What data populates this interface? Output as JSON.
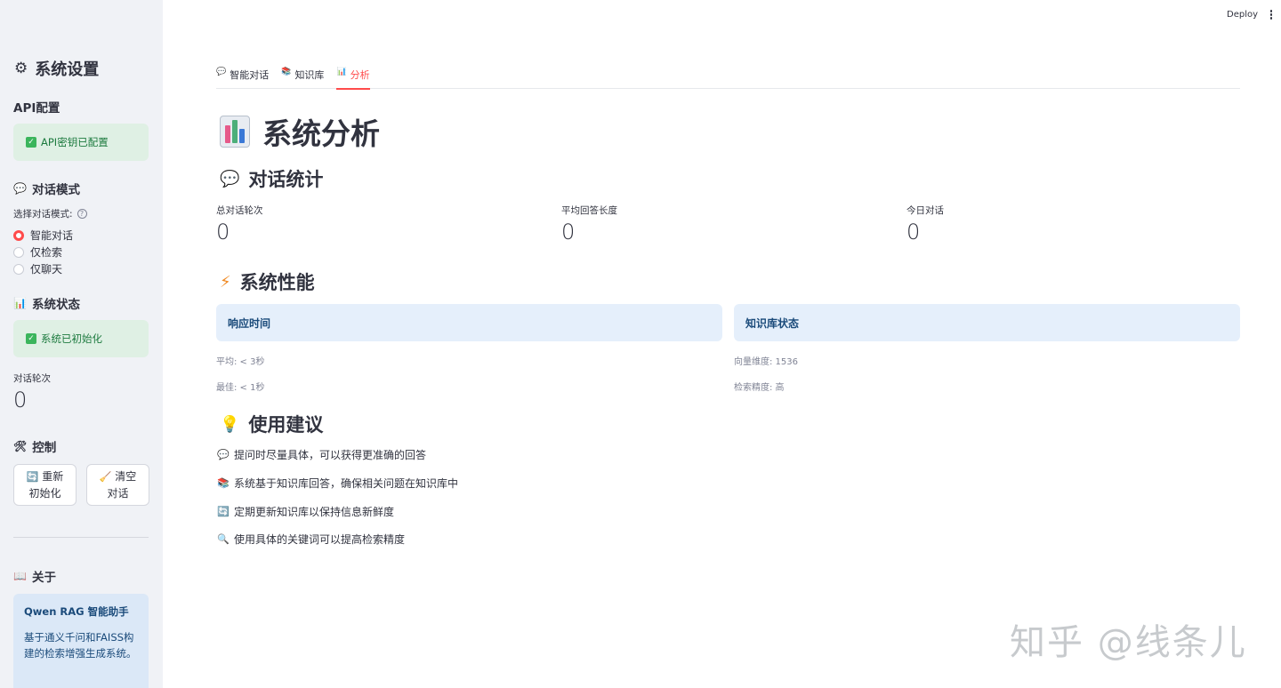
{
  "sidebar": {
    "title": "系统设置",
    "title_icon": "gear-icon",
    "api_header": "API配置",
    "api_status": "API密钥已配置",
    "mode_header": "对话模式",
    "mode_icon": "speech-bubble-icon",
    "radio_label": "选择对话模式:",
    "modes": [
      {
        "label": "智能对话",
        "selected": true
      },
      {
        "label": "仅检索",
        "selected": false
      },
      {
        "label": "仅聊天",
        "selected": false
      }
    ],
    "status_header": "系统状态",
    "status_icon": "bar-chart-icon",
    "status_text": "系统已初始化",
    "rounds_label": "对话轮次",
    "rounds_value": "0",
    "control_header": "控制",
    "control_icon": "tools-icon",
    "reinit_line1": "重新",
    "reinit_line2": "初始化",
    "clear_line1": "清空",
    "clear_line2": "对话",
    "about_header": "关于",
    "about_icon": "book-icon",
    "about_title": "Qwen RAG 智能助手",
    "about_desc": "基于通义千问和FAISS构建的检索增强生成系统。"
  },
  "topbar": {
    "deploy": "Deploy"
  },
  "tabs": [
    {
      "label": "智能对话",
      "icon": "speech-bubble-icon",
      "active": false
    },
    {
      "label": "知识库",
      "icon": "books-icon",
      "active": false
    },
    {
      "label": "分析",
      "icon": "bar-chart-icon",
      "active": true
    }
  ],
  "main": {
    "title": "系统分析",
    "stats_header": "对话统计",
    "stats": [
      {
        "label": "总对话轮次",
        "value": "0"
      },
      {
        "label": "平均回答长度",
        "value": "0"
      },
      {
        "label": "今日对话",
        "value": "0"
      }
    ],
    "perf_header": "系统性能",
    "perf_left_title": "响应时间",
    "perf_left_lines": [
      "平均: < 3秒",
      "最佳: < 1秒"
    ],
    "perf_right_title": "知识库状态",
    "perf_right_lines": [
      "向量维度: 1536",
      "检索精度: 高"
    ],
    "tips_header": "使用建议",
    "tips": [
      {
        "icon": "speech-bubble-icon",
        "text": "提问时尽量具体，可以获得更准确的回答"
      },
      {
        "icon": "books-icon",
        "text": "系统基于知识库回答，确保相关问题在知识库中"
      },
      {
        "icon": "refresh-icon",
        "text": "定期更新知识库以保持信息新鲜度"
      },
      {
        "icon": "magnifier-icon",
        "text": "使用具体的关键词可以提高检索精度"
      }
    ]
  },
  "watermark": "知乎 @线条儿",
  "colors": {
    "accent": "#ff4b4b",
    "sidebar_bg": "#f0f2f6",
    "success_bg": "#dff0e4",
    "info_bg": "#dbe8f7"
  }
}
